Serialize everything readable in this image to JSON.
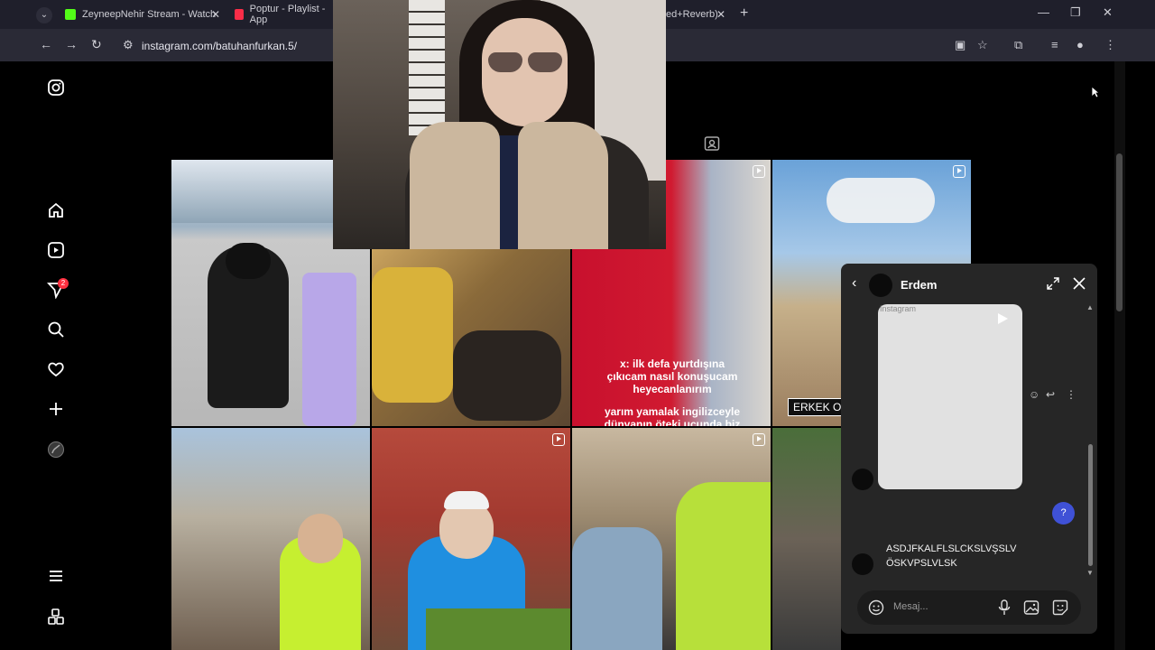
{
  "browser": {
    "tabs": [
      {
        "title": "ZeyneepNehir Stream - Watch",
        "favicon_color": "#53fc18"
      },
      {
        "title": "Poptur - Playlist - App",
        "favicon_color": "#fa2d48"
      },
      {
        "title": "ed+Reverb)"
      }
    ],
    "url": "instagram.com/batuhanfurkan.5/"
  },
  "sidebar": {
    "notifications_badge": "2"
  },
  "grid": {
    "captions": {
      "caption_1_line1": "x: ilk defa yurtdışına",
      "caption_1_line2": "çıkıcam nasıl konuşucam",
      "caption_1_line3": "heyecanlanırım",
      "caption_2_line1": "yarım yamalak ingilizceyle",
      "caption_2_line2": "dünyanın öteki ucunda biz"
    },
    "overlay_label": "ERKEK OLA"
  },
  "chat": {
    "name": "Erdem",
    "media_alt": "Instagram",
    "message_line1": "ASDJFKALFLSLCKSLVŞSLV",
    "message_line2": "ÖSKVPSLVLSK",
    "help_label": "?",
    "input_placeholder": "Mesaj..."
  },
  "colors": {
    "ig_background": "#000000",
    "chat_panel": "#262626",
    "help_button": "#3f51d6",
    "badge": "#ff3040"
  }
}
